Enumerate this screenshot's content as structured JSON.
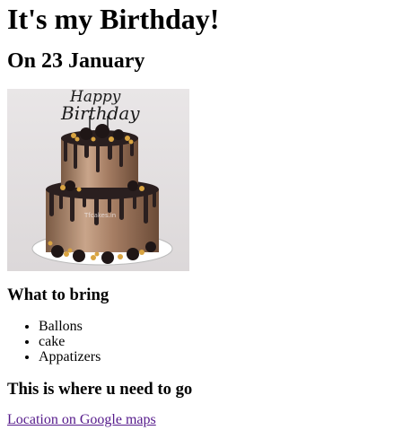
{
  "heading": "It's my Birthday!",
  "subheading": "On 23 January",
  "image": {
    "topper_line1": "Happy",
    "topper_line2": "Birthday",
    "watermark": "Tfcakes.in"
  },
  "bring_section": {
    "title": "What to bring",
    "items": [
      "Ballons",
      "cake",
      "Appatizers"
    ]
  },
  "go_section": {
    "title": "This is where u need to go",
    "link_text": "Location on Google maps"
  },
  "colors": {
    "link_visited": "#551a8b",
    "text": "#000000"
  }
}
